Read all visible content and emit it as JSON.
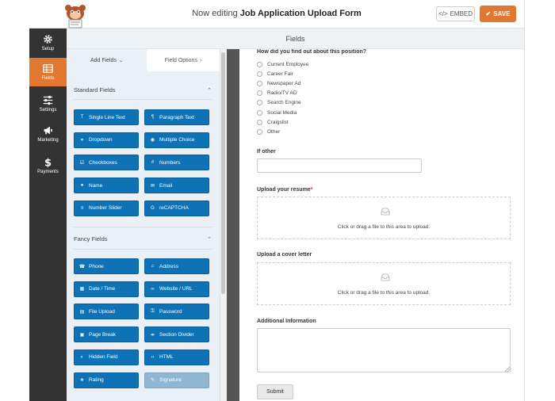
{
  "header": {
    "title_prefix": "Now editing",
    "title_form": "Job Application Upload Form",
    "embed_label": "EMBED",
    "save_label": "SAVE"
  },
  "sidebar": {
    "items": [
      {
        "label": "Setup",
        "icon": "gear-icon"
      },
      {
        "label": "Fields",
        "icon": "fields-icon",
        "active": true
      },
      {
        "label": "Settings",
        "icon": "sliders-icon"
      },
      {
        "label": "Marketing",
        "icon": "megaphone-icon"
      },
      {
        "label": "Payments",
        "icon": "dollar-icon"
      }
    ]
  },
  "subheader": {
    "title": "Fields"
  },
  "panel": {
    "tab_add": "Add Fields",
    "tab_options": "Field Options",
    "standard_title": "Standard Fields",
    "fancy_title": "Fancy Fields",
    "standard_fields": [
      "Single Line Text",
      "Paragraph Text",
      "Dropdown",
      "Multiple Choice",
      "Checkboxes",
      "Numbers",
      "Name",
      "Email",
      "Number Slider",
      "reCAPTCHA"
    ],
    "fancy_fields": [
      "Phone",
      "Address",
      "Date / Time",
      "Website / URL",
      "File Upload",
      "Password",
      "Page Break",
      "Section Divider",
      "Hidden Field",
      "HTML",
      "Rating",
      "Signature"
    ]
  },
  "preview": {
    "question_label": "How did you find out about this position?",
    "options": [
      "Current Employee",
      "Career Fair",
      "Newspaper Ad",
      "Radio/TV AD",
      "Search Engine",
      "Social Media",
      "Craigslist",
      "Other"
    ],
    "if_other_label": "If other",
    "resume_label": "Upload your resume",
    "required_marker": "*",
    "upload_text": "Click or drag a file to this area to upload.",
    "cover_label": "Upload a cover letter",
    "additional_label": "Additional Information",
    "submit_label": "Submit"
  },
  "colors": {
    "accent": "#e27730",
    "field_button": "#0e72b6",
    "sidebar_bg": "#333333",
    "panel_bg": "#eaf0f5"
  }
}
